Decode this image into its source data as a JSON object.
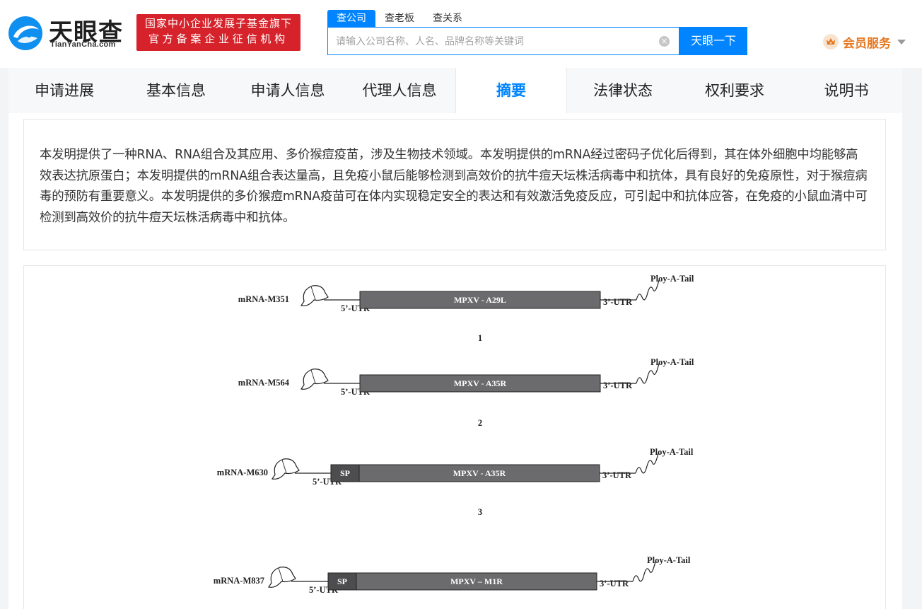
{
  "header": {
    "logo_cn": "天眼查",
    "logo_en": "TianYanCha.com",
    "badge_line1": "国家中小企业发展子基金旗下",
    "badge_line2": "官方备案企业征信机构",
    "search_tabs": [
      "查公司",
      "查老板",
      "查关系"
    ],
    "search_placeholder": "请输入公司名称、人名、品牌名称等关键词",
    "search_button": "天眼一下",
    "member_label": "会员服务"
  },
  "nav": {
    "tabs": [
      "申请进展",
      "基本信息",
      "申请人信息",
      "代理人信息",
      "摘要",
      "法律状态",
      "权利要求",
      "说明书"
    ],
    "active": "摘要"
  },
  "abstract": {
    "text": "本发明提供了一种RNA、RNA组合及其应用、多价猴痘疫苗，涉及生物技术领域。本发明提供的mRNA经过密码子优化后得到，其在体外细胞中均能够高效表达抗原蛋白；本发明提供的mRNA组合表达量高，且免疫小鼠后能够检测到高效价的抗牛痘天坛株活病毒中和抗体，具有良好的免疫原性，对于猴痘病毒的预防有重要意义。本发明提供的多价猴痘mRNA疫苗可在体内实现稳定安全的表达和有效激活免疫反应，可引起中和抗体应答，在免疫的小鼠血清中可检测到高效价的抗牛痘天坛株活病毒中和抗体。"
  },
  "figure": {
    "constructs": [
      {
        "name": "mRNA-M351",
        "utr5": "5’-UTR",
        "sp": "",
        "gene": "MPXV - A29L",
        "utr3": "3’-UTR",
        "tail": "Ploy-A-Tail",
        "number": "1"
      },
      {
        "name": "mRNA-M564",
        "utr5": "5’-UTR",
        "sp": "",
        "gene": "MPXV - A35R",
        "utr3": "3’-UTR",
        "tail": "Ploy-A-Tail",
        "number": "2"
      },
      {
        "name": "mRNA-M630",
        "utr5": "5’-UTR",
        "sp": "SP",
        "gene": "MPXV - A35R",
        "utr3": "3’-UTR",
        "tail": "Ploy-A-Tail",
        "number": "3"
      },
      {
        "name": "mRNA-M837",
        "utr5": "5’-UTR",
        "sp": "SP",
        "gene": "MPXV – M1R",
        "utr3": "3’-UTR",
        "tail": "Ploy-A-Tail",
        "number": ""
      }
    ]
  },
  "colors": {
    "brand_blue": "#0084ff",
    "badge_red": "#d6232b",
    "member_orange": "#e6771e",
    "gene_box": "#6b6a6c"
  }
}
